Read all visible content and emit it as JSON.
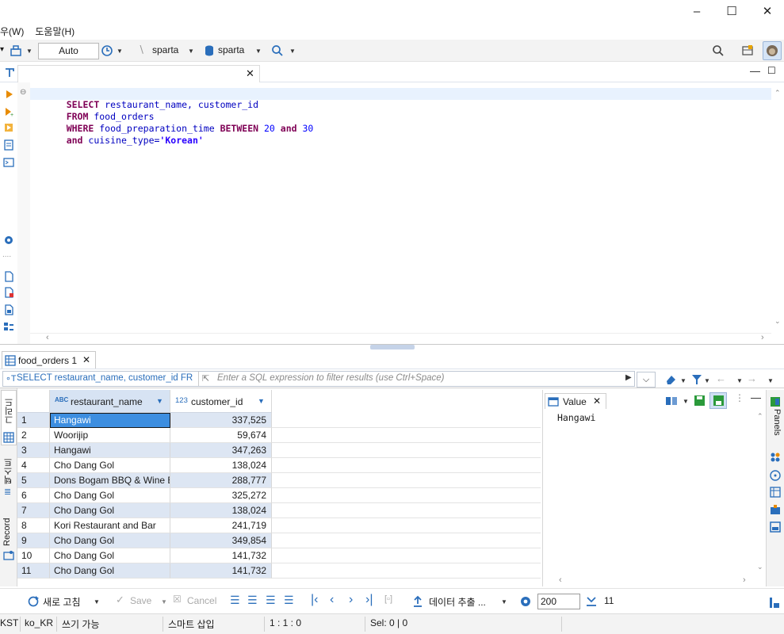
{
  "menu": {
    "window": "우(W)",
    "help": "도움말(H)"
  },
  "toolbar": {
    "commit_mode": "Auto",
    "datasource": "sparta",
    "schema": "sparta"
  },
  "editor": {
    "lines": [
      {
        "kw": "SELECT",
        "rest": " restaurant_name, customer_id"
      },
      {
        "kw": "FROM",
        "rest": " food_orders"
      },
      {
        "kw": "WHERE",
        "rest": " food_preparation_time ",
        "kw2": "BETWEEN",
        "n1": "20",
        "kw3": "and",
        "n2": "30"
      },
      {
        "kw": "and",
        "rest": " cuisine_type=",
        "str": "'Korean'"
      }
    ]
  },
  "results": {
    "tab_label": "food_orders 1",
    "query_preview": "SELECT restaurant_name, customer_id FR",
    "filter_placeholder": "Enter a SQL expression to filter results (use Ctrl+Space)",
    "columns": [
      {
        "type_badge": "ABC",
        "name": "restaurant_name"
      },
      {
        "type_badge": "123",
        "name": "customer_id"
      }
    ],
    "rows": [
      {
        "num": "1",
        "restaurant_name": "Hangawi",
        "customer_id": "337,525"
      },
      {
        "num": "2",
        "restaurant_name": "Woorijip",
        "customer_id": "59,674"
      },
      {
        "num": "3",
        "restaurant_name": "Hangawi",
        "customer_id": "347,263"
      },
      {
        "num": "4",
        "restaurant_name": "Cho Dang Gol",
        "customer_id": "138,024"
      },
      {
        "num": "5",
        "restaurant_name": "Dons Bogam BBQ & Wine B",
        "customer_id": "288,777"
      },
      {
        "num": "6",
        "restaurant_name": "Cho Dang Gol",
        "customer_id": "325,272"
      },
      {
        "num": "7",
        "restaurant_name": "Cho Dang Gol",
        "customer_id": "138,024"
      },
      {
        "num": "8",
        "restaurant_name": "Kori Restaurant and Bar",
        "customer_id": "241,719"
      },
      {
        "num": "9",
        "restaurant_name": "Cho Dang Gol",
        "customer_id": "349,854"
      },
      {
        "num": "10",
        "restaurant_name": "Cho Dang Gol",
        "customer_id": "141,732"
      },
      {
        "num": "11",
        "restaurant_name": "Cho Dang Gol",
        "customer_id": "141,732"
      }
    ],
    "side_tabs": {
      "grid": "그리드",
      "text": "텍스트",
      "record": "Record"
    },
    "value_panel": {
      "title": "Value",
      "content": "Hangawi"
    },
    "panels_label": "Panels"
  },
  "bottom_toolbar": {
    "refresh": "새로 고침",
    "save": "Save",
    "cancel": "Cancel",
    "export": "데이터 추출 ...",
    "fetch_size": "200",
    "row_count": "11"
  },
  "status": {
    "timezone": "KST",
    "locale": "ko_KR",
    "mode": "쓰기 가능",
    "insert_mode": "스마트 삽입",
    "position": "1 : 1 : 0",
    "selection": "Sel: 0 | 0"
  },
  "colors": {
    "accent": "#0078d7",
    "selection": "#3d8ee0",
    "alt_row": "#dde6f3",
    "keyword": "#7f0055"
  }
}
